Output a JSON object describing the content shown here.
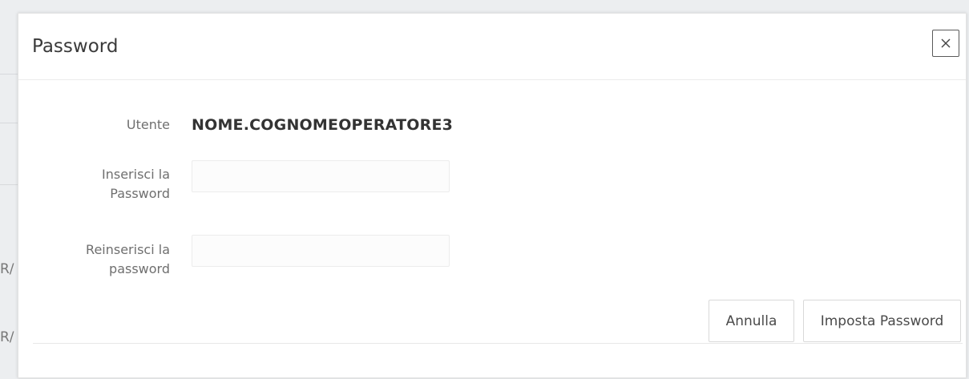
{
  "background": {
    "partial_text_1": "R/",
    "partial_text_2": "R/"
  },
  "dialog": {
    "title": "Password",
    "close_icon": "close-icon"
  },
  "form": {
    "user_label": "Utente",
    "user_value": "NOME.COGNOMEOPERATORE3",
    "password_label_line1": "Inserisci la",
    "password_label_line2": "Password",
    "password_value": "",
    "confirm_label_line1": "Reinserisci la",
    "confirm_label_line2": "password",
    "confirm_value": ""
  },
  "buttons": {
    "cancel_label": "Annulla",
    "submit_label": "Imposta Password"
  }
}
